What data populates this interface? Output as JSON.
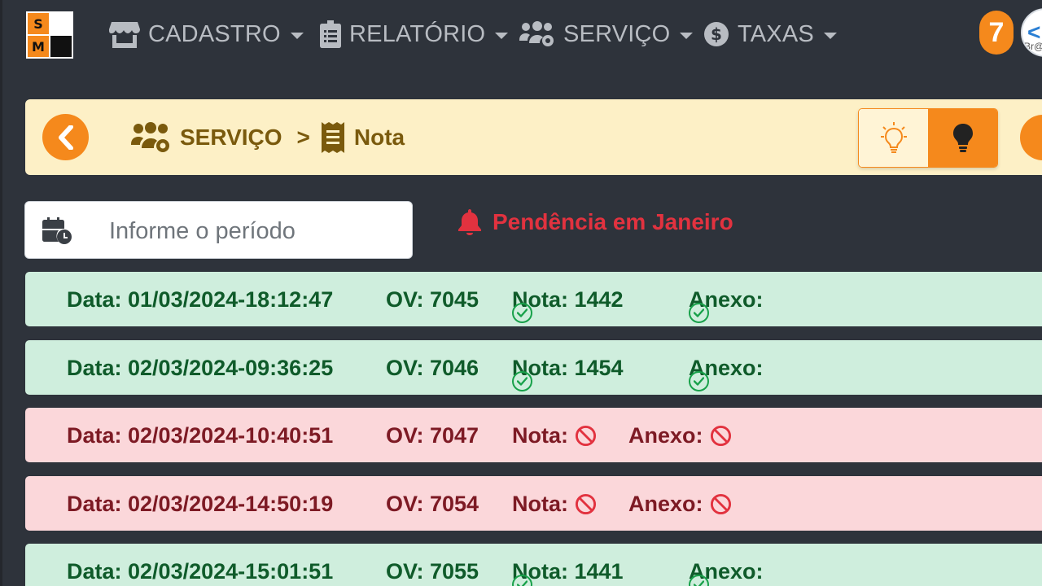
{
  "brand": {
    "logo_letters": [
      "S",
      "",
      "M",
      ""
    ]
  },
  "nav": {
    "items": [
      {
        "label": "CADASTRO",
        "icon": "store-icon"
      },
      {
        "label": "RELATÓRIO",
        "icon": "clipboard-list-icon"
      },
      {
        "label": "SERVIÇO",
        "icon": "users-gear-icon"
      },
      {
        "label": "TAXAS",
        "icon": "dollar-circle-icon"
      }
    ],
    "notification_count": "7",
    "avatar_text": "Br@"
  },
  "breadcrumb": {
    "section": "SERVIÇO",
    "separator": ">",
    "page": "Nota"
  },
  "period": {
    "placeholder": "Informe o período"
  },
  "pending_alert": "Pendência em Janeiro",
  "rows": [
    {
      "status": "ok",
      "data": "Data: 01/03/2024-18:12:47",
      "ov": "OV: 7045",
      "nota": "Nota: 1442",
      "anexo": "Anexo:"
    },
    {
      "status": "ok",
      "data": "Data: 02/03/2024-09:36:25",
      "ov": "OV: 7046",
      "nota": "Nota: 1454",
      "anexo": "Anexo:"
    },
    {
      "status": "pending",
      "data": "Data: 02/03/2024-10:40:51",
      "ov": "OV: 7047",
      "nota": "Nota:",
      "anexo": "Anexo:"
    },
    {
      "status": "pending",
      "data": "Data: 02/03/2024-14:50:19",
      "ov": "OV: 7054",
      "nota": "Nota:",
      "anexo": "Anexo:"
    },
    {
      "status": "ok",
      "data": "Data: 02/03/2024-15:01:51",
      "ov": "OV: 7055",
      "nota": "Nota: 1441",
      "anexo": "Anexo:"
    }
  ],
  "colors": {
    "accent": "#f5891c",
    "ok_bg": "#cfeedd",
    "pending_bg": "#fbd7da",
    "alert": "#e2323f"
  }
}
